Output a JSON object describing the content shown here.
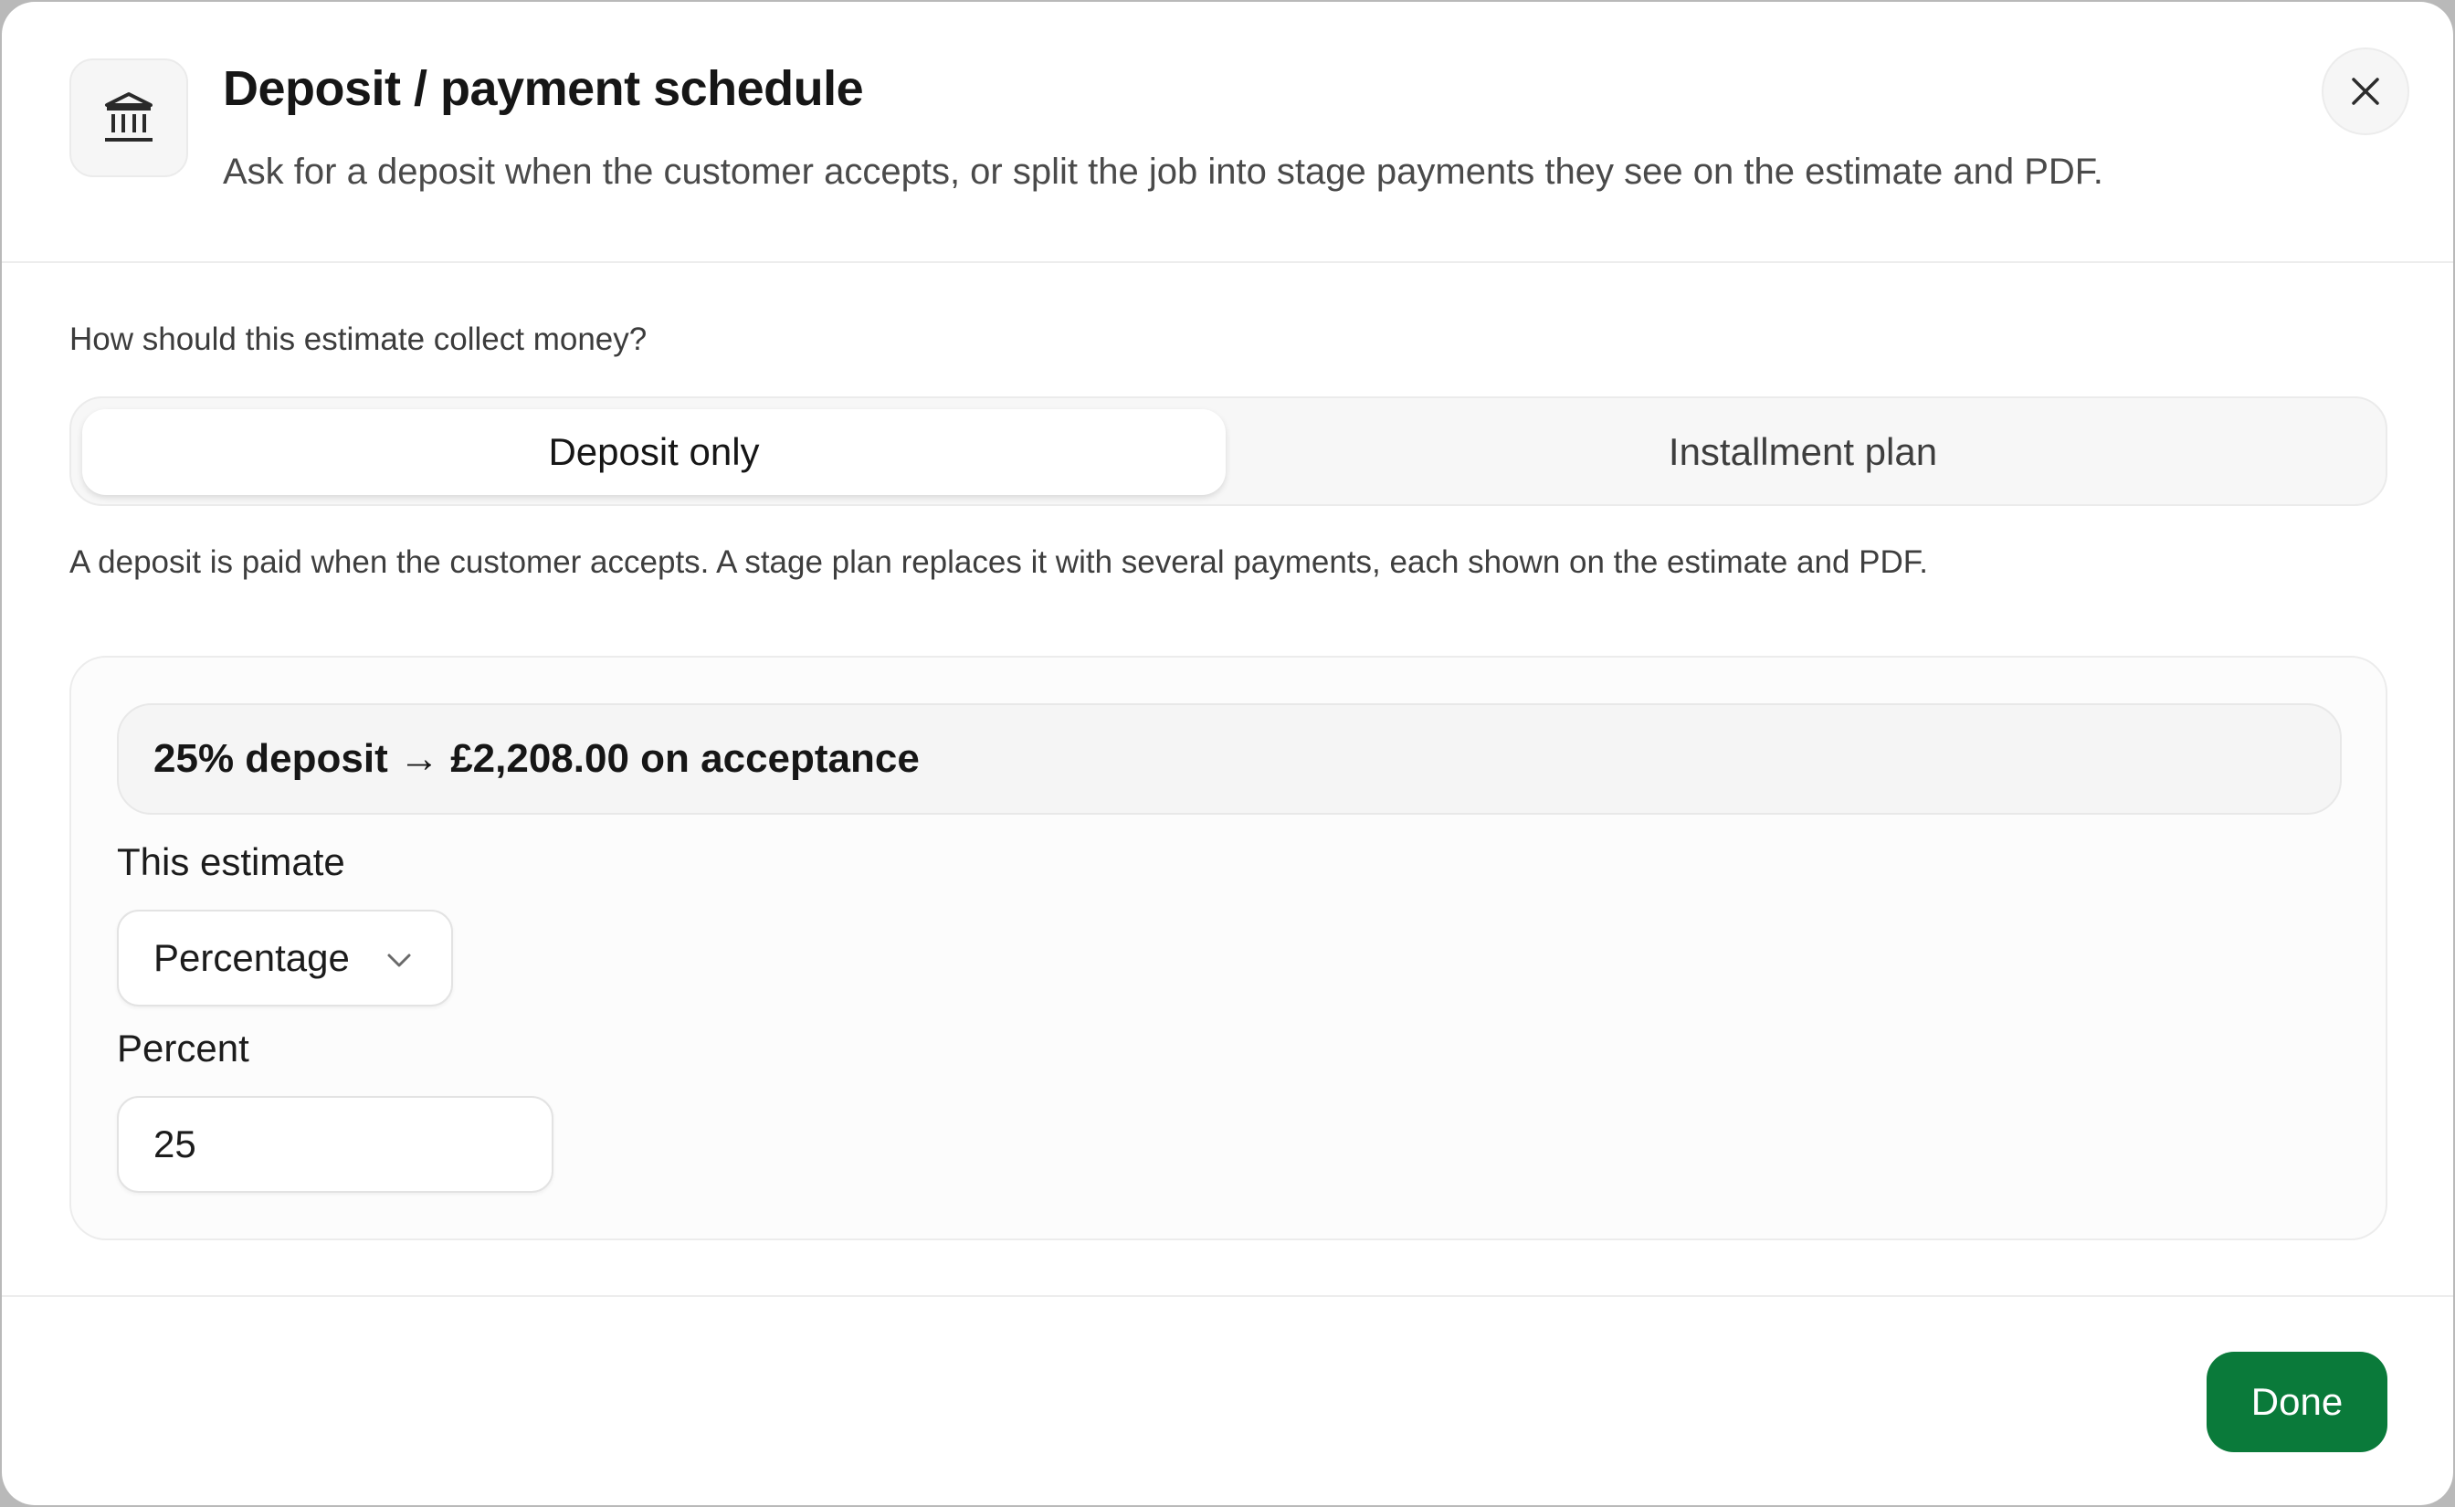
{
  "dialog": {
    "icon": "bank-icon",
    "title": "Deposit / payment schedule",
    "subtitle": "Ask for a deposit when the customer accepts, or split the job into stage payments they see on the estimate and PDF.",
    "close_icon": "close-icon"
  },
  "collection": {
    "question": "How should this estimate collect money?",
    "options": [
      {
        "label": "Deposit only",
        "selected": true
      },
      {
        "label": "Installment plan",
        "selected": false
      }
    ],
    "helper": "A deposit is paid when the customer accepts. A stage plan replaces it with several payments, each shown on the estimate and PDF."
  },
  "deposit": {
    "summary": "25% deposit → £2,208.00 on acceptance",
    "type_label": "This estimate",
    "type_value": "Percentage",
    "type_icon": "chevron-down-icon",
    "percent_label": "Percent",
    "percent_value": "25"
  },
  "footer": {
    "done_label": "Done"
  },
  "colors": {
    "accent": "#0a7a3a",
    "text": "#161616",
    "muted": "#4a4a4a"
  }
}
